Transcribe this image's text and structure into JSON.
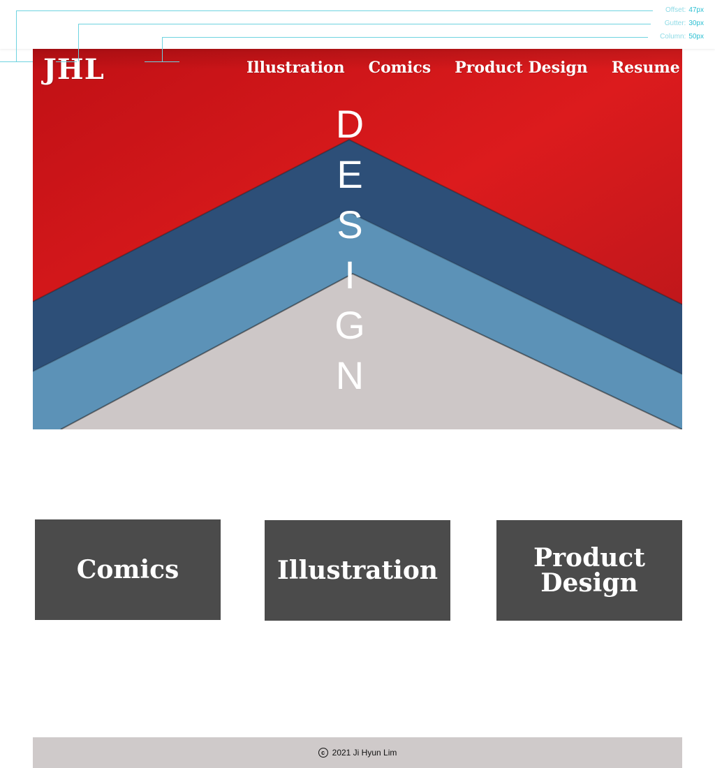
{
  "guides": {
    "offset_label": "Offset:",
    "offset_value": "47px",
    "gutter_label": "Gutter:",
    "gutter_value": "30px",
    "column_label": "Column:",
    "column_value": "50px"
  },
  "header": {
    "logo": "JHL",
    "nav": [
      "Illustration",
      "Comics",
      "Product Design",
      "Resume"
    ]
  },
  "hero": {
    "letters": [
      "D",
      "E",
      "S",
      "I",
      "G",
      "N"
    ]
  },
  "cards": [
    {
      "title": "Comics"
    },
    {
      "title": "Illustration"
    },
    {
      "title": "Product Design"
    }
  ],
  "footer": {
    "copyright_icon": "copyright-icon",
    "text": "2021 Ji Hyun Lim"
  },
  "colors": {
    "red": "#d3151a",
    "navy": "#2d4f78",
    "light_blue": "#5c92b7",
    "paper": "#cdc7c7",
    "card": "#4b4b4b",
    "guide": "#6ed3e0"
  }
}
